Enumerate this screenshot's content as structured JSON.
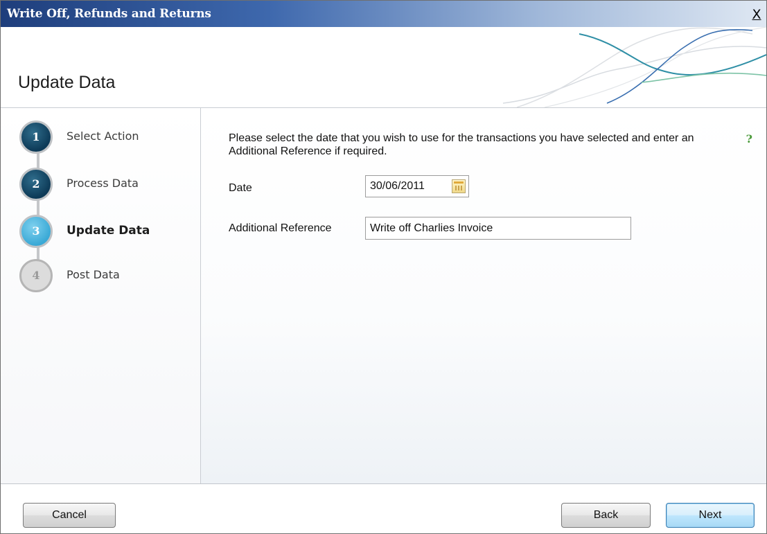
{
  "window": {
    "title": "Write Off, Refunds and Returns",
    "close_label": "X"
  },
  "header": {
    "page_title": "Update Data"
  },
  "steps": [
    {
      "number": "1",
      "label": "Select Action",
      "state": "done"
    },
    {
      "number": "2",
      "label": "Process Data",
      "state": "done"
    },
    {
      "number": "3",
      "label": "Update Data",
      "state": "active"
    },
    {
      "number": "4",
      "label": "Post Data",
      "state": "pending"
    }
  ],
  "content": {
    "instructions": "Please select the date that you wish to use for the transactions you have selected and enter an Additional Reference if required.",
    "help_icon": "?",
    "date_label": "Date",
    "date_value": "30/06/2011",
    "reference_label": "Additional Reference",
    "reference_value": "Write off Charlies Invoice"
  },
  "footer": {
    "cancel_label": "Cancel",
    "back_label": "Back",
    "next_label": "Next"
  },
  "colors": {
    "step_done": "#0d3a57",
    "step_active": "#3aa9d6",
    "step_pending": "#dcdcdc",
    "titlebar": "#1e3e7c"
  }
}
